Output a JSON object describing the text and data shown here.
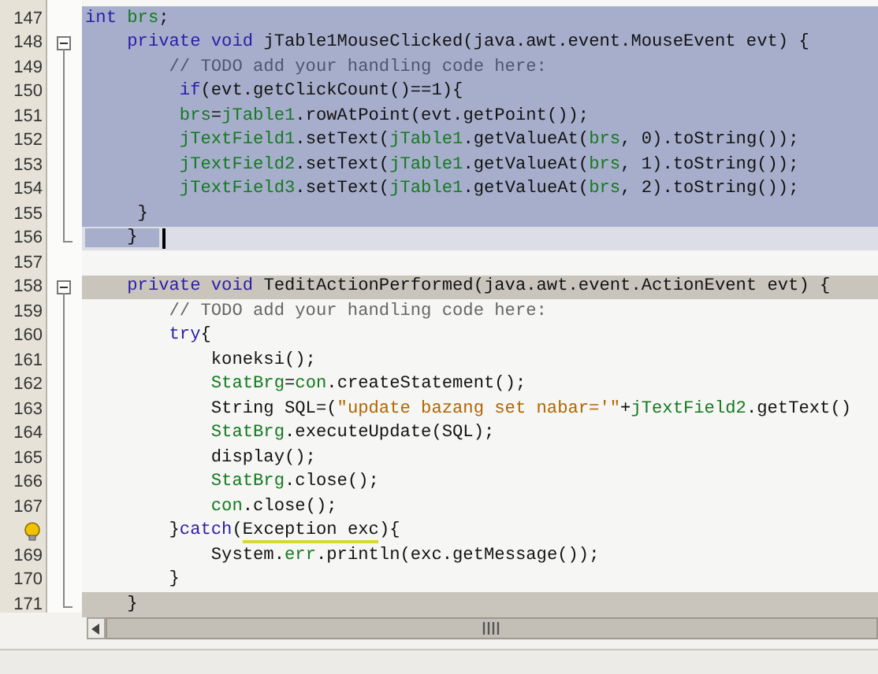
{
  "editor": {
    "lines": [
      {
        "number": "147",
        "selected": true,
        "tokens": [
          {
            "t": "int ",
            "kind": "keyword"
          },
          {
            "t": "brs",
            "kind": "field"
          },
          {
            "t": ";"
          }
        ]
      },
      {
        "number": "148",
        "selected": true,
        "fold_start": true,
        "tokens": [
          {
            "t": "    private void",
            "kind": "keyword"
          },
          {
            "t": " jTable1MouseClicked(java.awt.event.MouseEvent evt) {"
          }
        ]
      },
      {
        "number": "149",
        "selected": true,
        "in_fold": true,
        "tokens": [
          {
            "t": "        // TODO add your handling code here:",
            "kind": "comment"
          }
        ]
      },
      {
        "number": "150",
        "selected": true,
        "in_fold": true,
        "tokens": [
          {
            "t": "         if",
            "kind": "keyword"
          },
          {
            "t": "(evt.getClickCount()==1){"
          }
        ]
      },
      {
        "number": "151",
        "selected": true,
        "in_fold": true,
        "tokens": [
          {
            "t": "         brs",
            "kind": "field"
          },
          {
            "t": "="
          },
          {
            "t": "jTable1",
            "kind": "field"
          },
          {
            "t": ".rowAtPoint(evt.getPoint());"
          }
        ]
      },
      {
        "number": "152",
        "selected": true,
        "in_fold": true,
        "tokens": [
          {
            "t": "         jTextField1",
            "kind": "field"
          },
          {
            "t": ".setText("
          },
          {
            "t": "jTable1",
            "kind": "field"
          },
          {
            "t": ".getValueAt("
          },
          {
            "t": "brs",
            "kind": "field"
          },
          {
            "t": ", 0).toString());"
          }
        ]
      },
      {
        "number": "153",
        "selected": true,
        "in_fold": true,
        "tokens": [
          {
            "t": "         jTextField2",
            "kind": "field"
          },
          {
            "t": ".setText("
          },
          {
            "t": "jTable1",
            "kind": "field"
          },
          {
            "t": ".getValueAt("
          },
          {
            "t": "brs",
            "kind": "field"
          },
          {
            "t": ", 1).toString());"
          }
        ]
      },
      {
        "number": "154",
        "selected": true,
        "in_fold": true,
        "tokens": [
          {
            "t": "         jTextField3",
            "kind": "field"
          },
          {
            "t": ".setText("
          },
          {
            "t": "jTable1",
            "kind": "field"
          },
          {
            "t": ".getValueAt("
          },
          {
            "t": "brs",
            "kind": "field"
          },
          {
            "t": ", 2).toString());"
          }
        ]
      },
      {
        "number": "155",
        "selected": true,
        "in_fold": true,
        "tokens": [
          {
            "t": "     }"
          }
        ]
      },
      {
        "number": "156",
        "selected": false,
        "current": true,
        "fold_end": true,
        "caret": true,
        "tokens": [
          {
            "t": "    }"
          }
        ]
      },
      {
        "number": "157",
        "selected": false
      },
      {
        "number": "158",
        "selected": false,
        "highlighted": true,
        "fold_start": true,
        "tokens": [
          {
            "t": "    private void",
            "kind": "keyword"
          },
          {
            "t": " TeditActionPerformed(java.awt.event.ActionEvent evt) {"
          }
        ]
      },
      {
        "number": "159",
        "selected": false,
        "in_fold": true,
        "tokens": [
          {
            "t": "        // TODO add your handling code here:",
            "kind": "comment"
          }
        ]
      },
      {
        "number": "160",
        "selected": false,
        "in_fold": true,
        "tokens": [
          {
            "t": "        try",
            "kind": "keyword"
          },
          {
            "t": "{"
          }
        ]
      },
      {
        "number": "161",
        "selected": false,
        "in_fold": true,
        "tokens": [
          {
            "t": "            koneksi();"
          }
        ]
      },
      {
        "number": "162",
        "selected": false,
        "in_fold": true,
        "tokens": [
          {
            "t": "            StatBrg",
            "kind": "field"
          },
          {
            "t": "="
          },
          {
            "t": "con",
            "kind": "field"
          },
          {
            "t": ".createStatement();"
          }
        ]
      },
      {
        "number": "163",
        "selected": false,
        "in_fold": true,
        "tokens": [
          {
            "t": "            String SQL=("
          },
          {
            "t": "\"update bazang set nabar='\"",
            "kind": "string"
          },
          {
            "t": "+"
          },
          {
            "t": "jTextField2",
            "kind": "field"
          },
          {
            "t": ".getText()"
          }
        ]
      },
      {
        "number": "164",
        "selected": false,
        "in_fold": true,
        "tokens": [
          {
            "t": "            StatBrg",
            "kind": "field"
          },
          {
            "t": ".executeUpdate(SQL);"
          }
        ]
      },
      {
        "number": "165",
        "selected": false,
        "in_fold": true,
        "tokens": [
          {
            "t": "            display();"
          }
        ]
      },
      {
        "number": "166",
        "selected": false,
        "in_fold": true,
        "tokens": [
          {
            "t": "            StatBrg",
            "kind": "field"
          },
          {
            "t": ".close();"
          }
        ]
      },
      {
        "number": "167",
        "selected": false,
        "in_fold": true,
        "tokens": [
          {
            "t": "            con",
            "kind": "field"
          },
          {
            "t": ".close();"
          }
        ]
      },
      {
        "hint": true,
        "selected": false,
        "in_fold": true,
        "tokens": [
          {
            "t": "        }"
          },
          {
            "t": "catch",
            "kind": "keyword"
          },
          {
            "t": "("
          },
          {
            "t": "Exception exc",
            "kind": "warning"
          },
          {
            "t": "){"
          }
        ]
      },
      {
        "number": "169",
        "selected": false,
        "in_fold": true,
        "tokens": [
          {
            "t": "            System."
          },
          {
            "t": "err",
            "kind": "field"
          },
          {
            "t": ".println(exc.getMessage());"
          }
        ]
      },
      {
        "number": "170",
        "selected": false,
        "in_fold": true,
        "tokens": [
          {
            "t": "        }"
          }
        ]
      },
      {
        "number": "171",
        "selected": false,
        "highlighted": true,
        "fold_end": true,
        "tokens": [
          {
            "t": "    }"
          }
        ]
      }
    ]
  }
}
